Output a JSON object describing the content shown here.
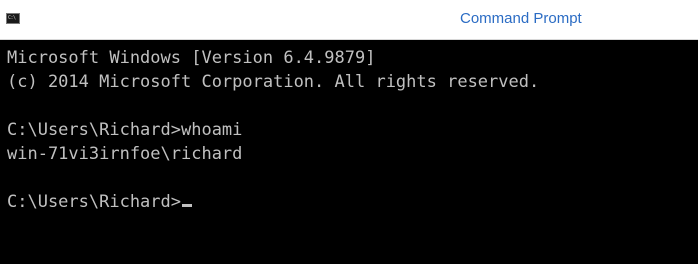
{
  "window": {
    "title": "Command Prompt",
    "icon": "cmd-icon",
    "icon_glyph": "C:\\"
  },
  "colors": {
    "background": "#000000",
    "text": "#c0c0c0",
    "titlebar": "#ffffff",
    "title_text": "#2b6cc4"
  },
  "console": {
    "lines": [
      "Microsoft Windows [Version 6.4.9879]",
      "(c) 2014 Microsoft Corporation. All rights reserved.",
      "",
      "C:\\Users\\Richard>whoami",
      "win-71vi3irnfoe\\richard",
      "",
      "C:\\Users\\Richard>"
    ]
  }
}
